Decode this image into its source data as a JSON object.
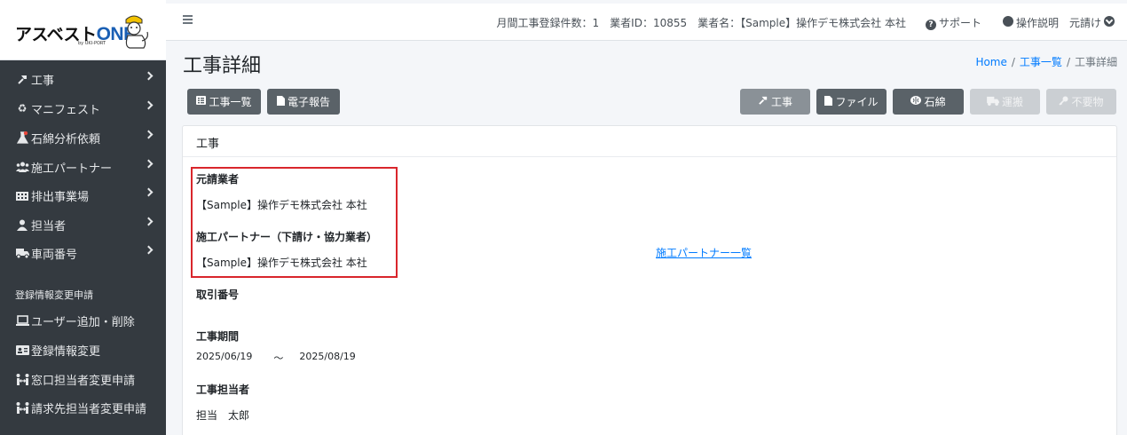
{
  "sidebar": {
    "brand": {
      "name_a": "アスベスト",
      "name_b": "ONE",
      "sub": "by UKI-PORT"
    },
    "items": [
      {
        "label": "工事",
        "icon": "hammer-icon"
      },
      {
        "label": "マニフェスト",
        "icon": "recycle-icon"
      },
      {
        "label": "石綿分析依頼",
        "icon": "flask-icon"
      },
      {
        "label": "施工パートナー",
        "icon": "users-icon"
      },
      {
        "label": "排出事業場",
        "icon": "building-icon"
      },
      {
        "label": "担当者",
        "icon": "user-icon"
      },
      {
        "label": "車両番号",
        "icon": "truck-icon"
      }
    ],
    "section_header": "登録情報変更申請",
    "sub_items": [
      {
        "label": "ユーザー追加・削除",
        "icon": "laptop-icon"
      },
      {
        "label": "登録情報変更",
        "icon": "id-card-icon"
      },
      {
        "label": "窓口担当者変更申請",
        "icon": "people-arrows-icon"
      },
      {
        "label": "請求先担当者変更申請",
        "icon": "people-arrows-icon"
      }
    ]
  },
  "topbar": {
    "monthly_count": "月間工事登録件数：1",
    "vendor_id": "業者ID：10855",
    "vendor_name": "業者名：【Sample】操作デモ株式会社 本社",
    "support": "サポート",
    "manual": "操作説明",
    "user": "元請け"
  },
  "page": {
    "title": "工事詳細",
    "breadcrumb": {
      "home": "Home",
      "list": "工事一覧",
      "current": "工事詳細"
    }
  },
  "buttons": {
    "list": "工事一覧",
    "report": "電子報告",
    "construction": "工事",
    "file": "ファイル",
    "asbestos": "石綿",
    "transport": "運搬",
    "waste": "不要物"
  },
  "card": {
    "header": "工事",
    "prime_label": "元請業者",
    "prime_value": "【Sample】操作デモ株式会社 本社",
    "partner_label": "施工パートナー（下請け・協力業者）",
    "partner_value": "【Sample】操作デモ株式会社 本社",
    "partner_link": "施工パートナー一覧",
    "deal_label": "取引番号",
    "period_label": "工事期間",
    "period_start": "2025/06/19",
    "period_sep": "〜",
    "period_end": "2025/08/19",
    "manager_label": "工事担当者",
    "manager_value": "担当　太郎"
  },
  "colors": {
    "sidebar": "#343a40",
    "highlight": "#d9262c",
    "link": "#007bff"
  }
}
